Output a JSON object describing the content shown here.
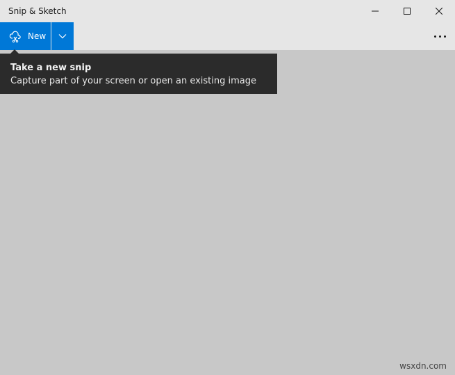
{
  "window": {
    "title": "Snip & Sketch",
    "controls": {
      "minimize": "minimize-icon",
      "maximize": "maximize-icon",
      "close": "close-icon"
    }
  },
  "toolbar": {
    "new_label": "New",
    "new_icon": "snip-icon",
    "dropdown_icon": "chevron-down-icon",
    "more_icon": "more-icon",
    "accent_color": "#0078d7"
  },
  "tooltip": {
    "title": "Take a new snip",
    "description": "Capture part of your screen or open an existing image"
  },
  "watermark": "wsxdn.com"
}
